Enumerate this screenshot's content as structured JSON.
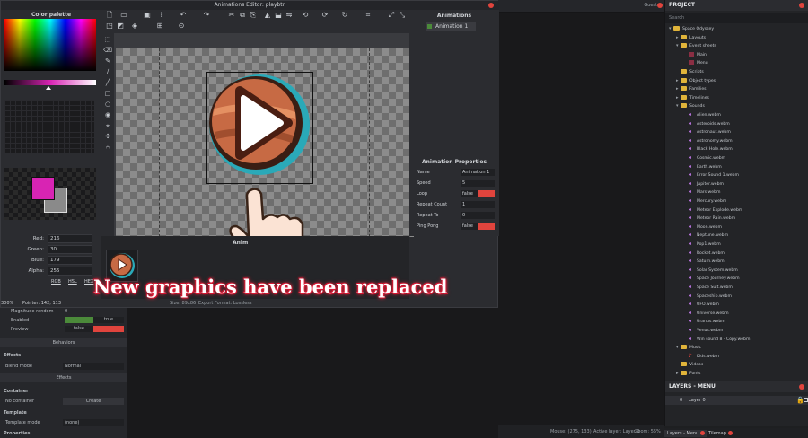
{
  "topbar": {
    "user": "Guest"
  },
  "editor": {
    "title": "Animations Editor: playbtn",
    "color_palette_title": "Color palette",
    "rgb": [
      {
        "label": "Red:",
        "value": "216"
      },
      {
        "label": "Green:",
        "value": "30"
      },
      {
        "label": "Blue:",
        "value": "179"
      },
      {
        "label": "Alpha:",
        "value": "255"
      }
    ],
    "color_modes": [
      "RGB",
      "HSL",
      "HEX"
    ],
    "primary_color": "#d824b3",
    "secondary_color": "#8a8a8a",
    "animations_title": "Animations",
    "animations": [
      "Animation 1"
    ],
    "anim_props_title": "Animation Properties",
    "anim_props": [
      {
        "label": "Name",
        "value": "Animation 1",
        "type": "text"
      },
      {
        "label": "Speed",
        "value": "5",
        "type": "text"
      },
      {
        "label": "Loop",
        "value": "false",
        "type": "toggle"
      },
      {
        "label": "Repeat Count",
        "value": "1",
        "type": "text"
      },
      {
        "label": "Repeat To",
        "value": "0",
        "type": "text"
      },
      {
        "label": "Ping Pong",
        "value": "false",
        "type": "toggle"
      }
    ],
    "frames_label": "Anim",
    "zoom": "300%",
    "pointer": "Pointer: 142, 113",
    "size": "Size: 89x86",
    "export_format": "Export Format: Lossless"
  },
  "overlay_text": "New graphics have been replaced",
  "props": {
    "rows": [
      {
        "label": "Magnitude random",
        "value": "0"
      },
      {
        "label": "Enabled",
        "value": "true",
        "kind": "green"
      },
      {
        "label": "Preview",
        "value": "false",
        "kind": "red"
      }
    ],
    "behaviors": "Behaviors",
    "effects_head": "Effects",
    "blend_label": "Blend mode",
    "blend_value": "Normal",
    "effects_btn": "Effects",
    "container_head": "Container",
    "no_container": "No container",
    "create": "Create",
    "template_head": "Template",
    "template_mode_label": "Template mode",
    "template_mode_value": "(none)",
    "properties_head": "Properties"
  },
  "statusbar": {
    "mouse": "Mouse: (275, 133)",
    "active_layer": "Active layer: Layer 0",
    "zoom": "Zoom: 55%"
  },
  "project": {
    "title": "PROJECT",
    "search_placeholder": "Search",
    "root": "Space Odyssey",
    "folders": [
      "Layouts",
      "Event sheets"
    ],
    "event_sheets": [
      "Main",
      "Menu"
    ],
    "folders2": [
      "Scripts",
      "Object types",
      "Families",
      "Timelines",
      "Sounds"
    ],
    "sounds": [
      "Alien.webm",
      "Asteroids.webm",
      "Astronaut.webm",
      "Astronomy.webm",
      "Black Hole.webm",
      "Cosmic.webm",
      "Earth.webm",
      "Error Sound 1.webm",
      "Jupiter.webm",
      "Mars.webm",
      "Mercury.webm",
      "Meteor Explode.webm",
      "Meteor Rain.webm",
      "Moon.webm",
      "Neptune.webm",
      "Pop1.webm",
      "Rocket.webm",
      "Saturn.webm",
      "Solar System.webm",
      "Space Journey.webm",
      "Space Suit.webm",
      "Spaceship.webm",
      "UFO.webm",
      "Universe.webm",
      "Uranus.webm",
      "Venus.webm",
      "Win sound 8 - Copy.webm"
    ],
    "music_folder": "Music",
    "music": [
      "Kids.webm"
    ],
    "folders3": [
      "Videos",
      "Fonts"
    ]
  },
  "layers": {
    "title": "LAYERS - MENU",
    "row_index": "0",
    "row_name": "Layer 0"
  },
  "bottom_tabs": [
    "Layers - Menu",
    "Tilemap"
  ]
}
